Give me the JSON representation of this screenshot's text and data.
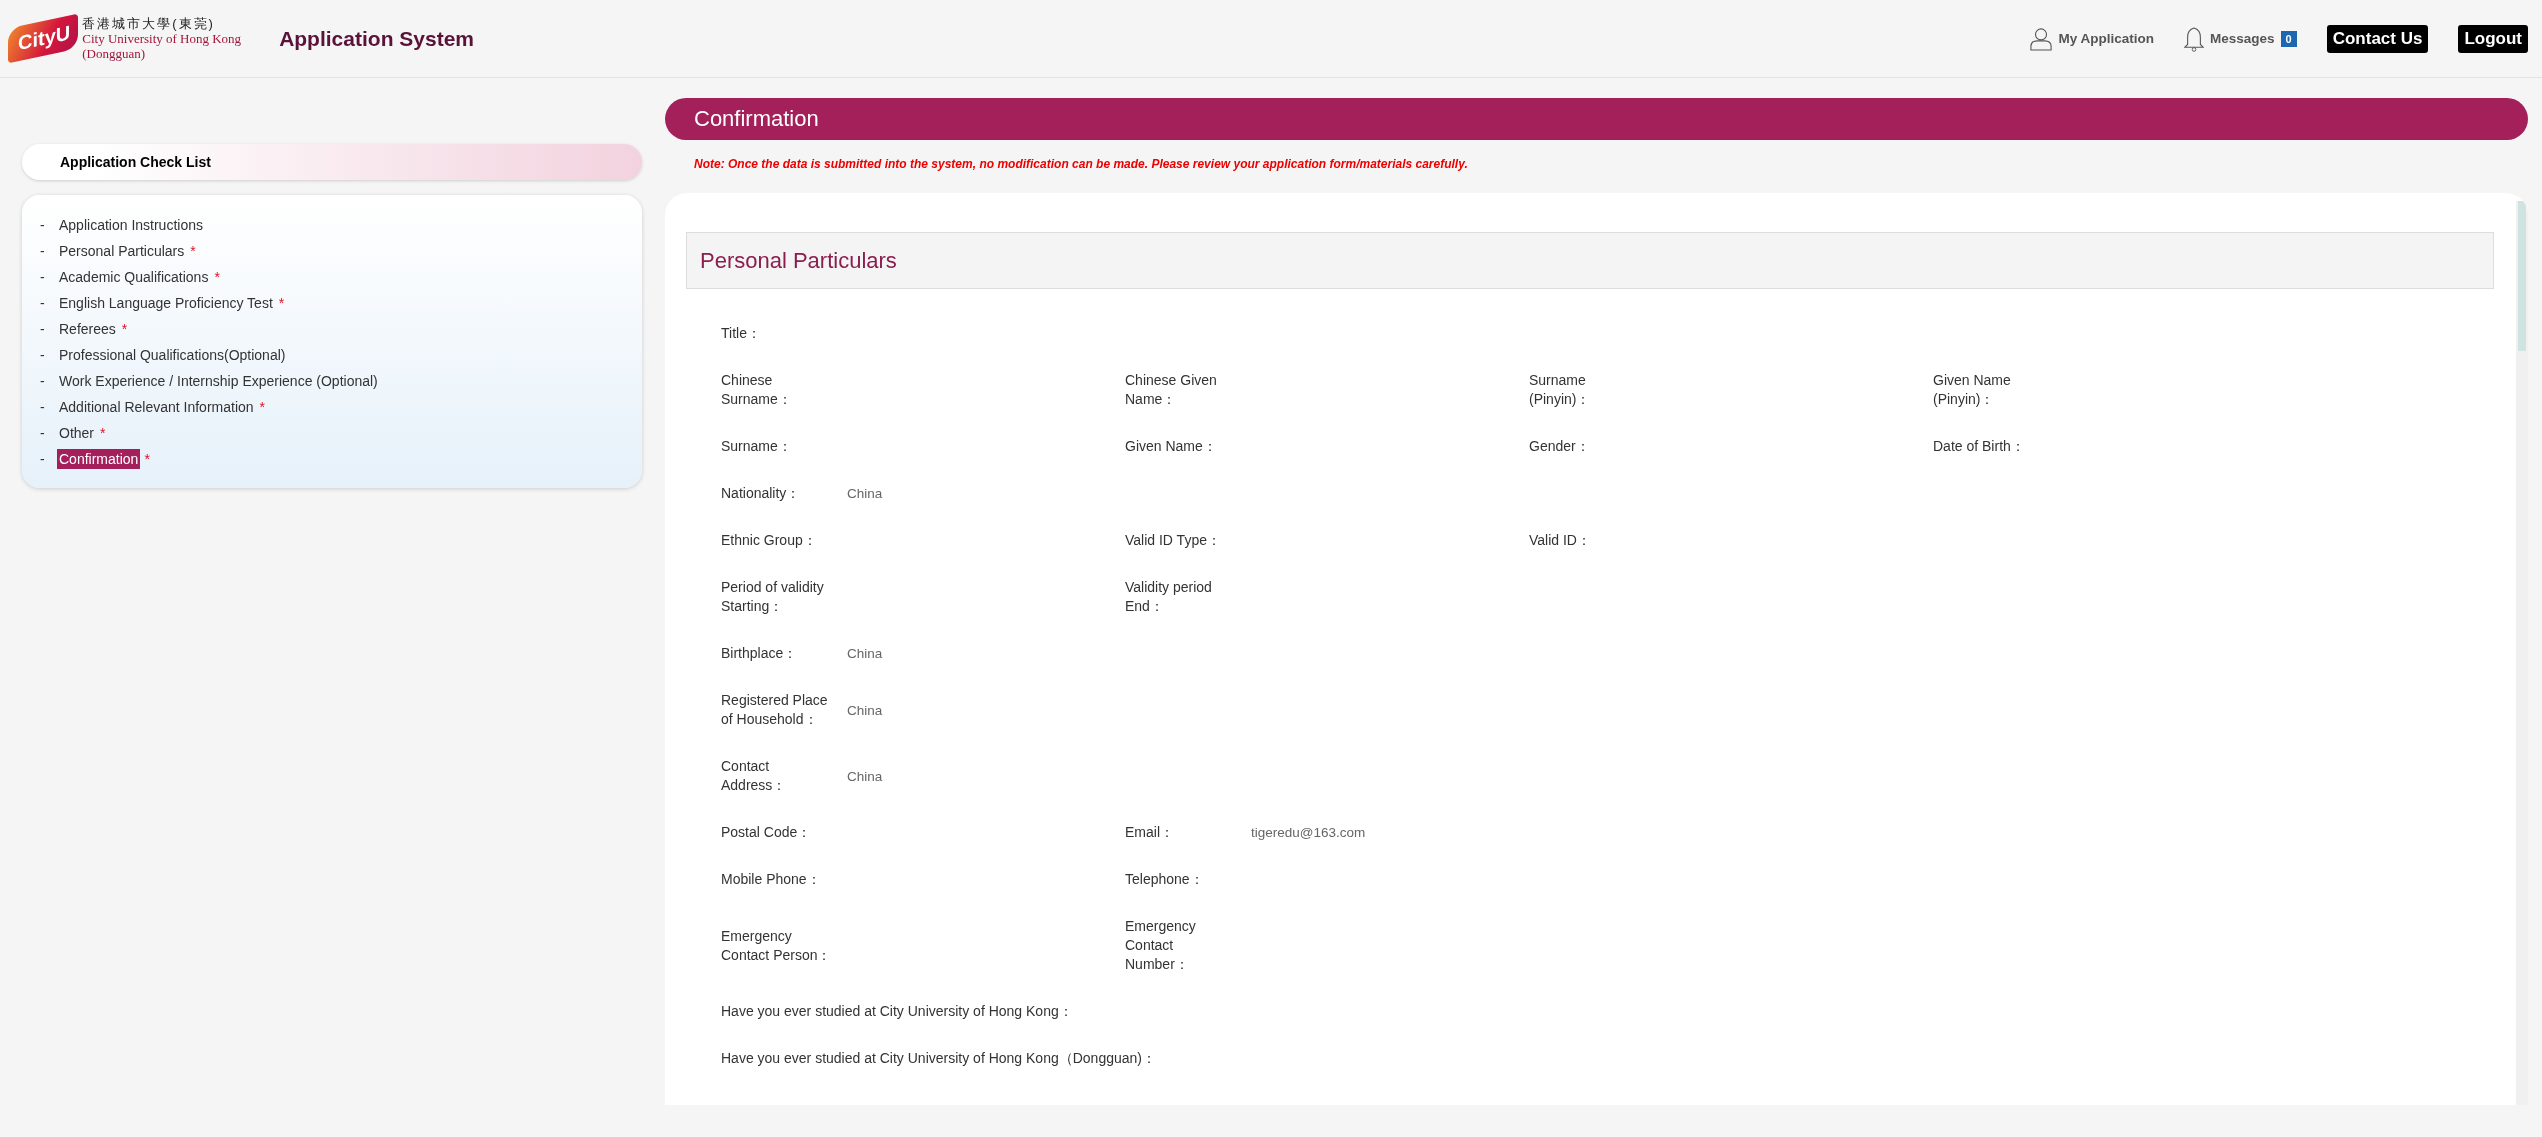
{
  "header": {
    "logo_mark": "CityU",
    "logo_chinese": "香港城市大學(東莞)",
    "logo_english": "City University of Hong Kong",
    "logo_english_sub": "(Dongguan)",
    "app_title": "Application System",
    "nav": {
      "my_application": "My Application",
      "messages": "Messages",
      "message_count": "0",
      "buttons": [
        "Contact Us",
        "Logout"
      ]
    }
  },
  "sidebar": {
    "title": "Application Check List",
    "items": [
      {
        "marker": "-",
        "label": "Application Instructions",
        "selected": false
      },
      {
        "marker": "-",
        "label": "Personal Particulars",
        "required_mark": "*",
        "selected": false
      },
      {
        "marker": "-",
        "label": "Academic Qualifications",
        "required_mark": "*",
        "selected": false
      },
      {
        "marker": "-",
        "label": "English Language Proficiency Test",
        "required_mark": "*",
        "selected": false
      },
      {
        "marker": "-",
        "label": "Referees",
        "required_mark": "*",
        "selected": false
      },
      {
        "marker": "-",
        "label": "Professional Qualifications(Optional)",
        "selected": false
      },
      {
        "marker": "-",
        "label": "Work Experience / Internship Experience (Optional)",
        "selected": false
      },
      {
        "marker": "-",
        "label": "Additional Relevant Information",
        "required_mark": "*",
        "selected": false
      },
      {
        "marker": "-",
        "label": "Other",
        "required_mark": "*",
        "selected": false
      },
      {
        "marker": "-",
        "label": "Confirmation",
        "required_mark": "*",
        "selected": true
      }
    ]
  },
  "page": {
    "title": "Confirmation",
    "note": "Note: Once the data is submitted into the system, no modification can be made. Please review your application form/materials carefully.",
    "section": {
      "title": "Personal Particulars",
      "rows": [
        {
          "kind": "grid",
          "fields": [
            {
              "label": "Title："
            }
          ]
        },
        {
          "kind": "grid",
          "fields": [
            {
              "label": "Chinese Surname："
            },
            {
              "label": "Chinese Given Name："
            },
            {
              "label": "Surname (Pinyin)："
            },
            {
              "label": "Given Name (Pinyin)："
            }
          ]
        },
        {
          "kind": "grid",
          "fields": [
            {
              "label": "Surname："
            },
            {
              "label": "Given Name："
            },
            {
              "label": "Gender："
            },
            {
              "label": "Date of Birth："
            }
          ]
        },
        {
          "kind": "grid",
          "fields": [
            {
              "label": "Nationality：",
              "value": "China"
            }
          ]
        },
        {
          "kind": "grid",
          "fields": [
            {
              "label": "Ethnic Group："
            },
            {
              "label": "Valid ID Type："
            },
            {
              "label": "Valid ID："
            }
          ]
        },
        {
          "kind": "grid",
          "fields": [
            {
              "label": "Period of validity Starting："
            },
            {
              "label": "Validity period End："
            }
          ]
        },
        {
          "kind": "grid",
          "fields": [
            {
              "label": "Birthplace：",
              "value": "China"
            }
          ]
        },
        {
          "kind": "grid",
          "fields": [
            {
              "label": "Registered Place of Household：",
              "value": "China"
            }
          ]
        },
        {
          "kind": "grid",
          "fields": [
            {
              "label": "Contact Address：",
              "value": "China"
            }
          ]
        },
        {
          "kind": "grid",
          "fields": [
            {
              "label": "Postal Code："
            },
            {
              "label": "Email：",
              "value": "tigeredu@163.com"
            }
          ]
        },
        {
          "kind": "grid",
          "fields": [
            {
              "label": "Mobile Phone："
            },
            {
              "label": "Telephone："
            }
          ]
        },
        {
          "kind": "grid",
          "fields": [
            {
              "label": "Emergency Contact Person："
            },
            {
              "label": "Emergency Contact Number："
            }
          ]
        },
        {
          "kind": "wide",
          "fields": [
            {
              "label": "Have you ever studied at City University of Hong Kong："
            }
          ]
        },
        {
          "kind": "wide",
          "fields": [
            {
              "label": "Have you ever studied at City University of Hong Kong（Dongguan)："
            }
          ]
        }
      ]
    }
  }
}
